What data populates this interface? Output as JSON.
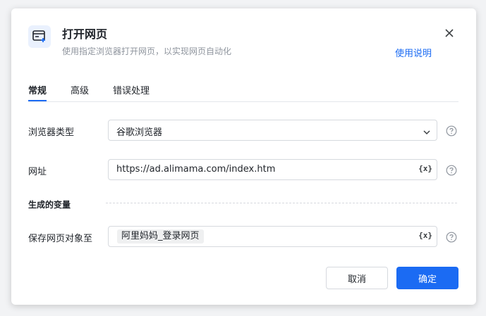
{
  "dialog": {
    "icon": "browser-open-icon",
    "title": "打开网页",
    "subtitle": "使用指定浏览器打开网页，以实现网页自动化",
    "help_link": "使用说明",
    "close_icon": "close-icon"
  },
  "tabs": [
    {
      "label": "常规",
      "active": true
    },
    {
      "label": "高级",
      "active": false
    },
    {
      "label": "错误处理",
      "active": false
    }
  ],
  "form": {
    "browser_type": {
      "label": "浏览器类型",
      "value": "谷歌浏览器"
    },
    "url": {
      "label": "网址",
      "value": "https://ad.alimama.com/index.htm",
      "var_button": "{x}"
    },
    "output_section": {
      "title": "生成的变量"
    },
    "save_page_object": {
      "label": "保存网页对象至",
      "value": "阿里妈妈_登录网页",
      "var_button": "{x}"
    }
  },
  "footer": {
    "cancel_label": "取消",
    "ok_label": "确定"
  },
  "colors": {
    "accent": "#1b6bf3",
    "icon_bg": "#eaf1fe"
  }
}
